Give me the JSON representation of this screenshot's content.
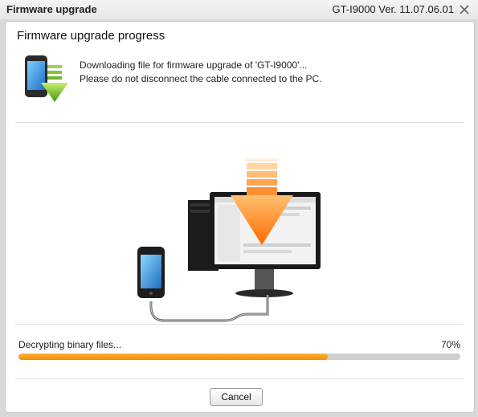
{
  "window": {
    "title": "Firmware upgrade",
    "version": "GT-I9000 Ver. 11.07.06.01",
    "close_icon": "close-icon"
  },
  "panel": {
    "heading": "Firmware upgrade progress",
    "message_line1": "Downloading file for firmware upgrade of 'GT-I9000'...",
    "message_line2": "Please do not disconnect the cable connected to the PC."
  },
  "progress": {
    "status": "Decrypting binary files...",
    "percent_label": "70%",
    "value": 0.7,
    "color": "#f29000"
  },
  "buttons": {
    "cancel": "Cancel"
  },
  "icons": {
    "header": "phone-download-icon",
    "illustration": "phone-to-pc-download-illustration"
  }
}
